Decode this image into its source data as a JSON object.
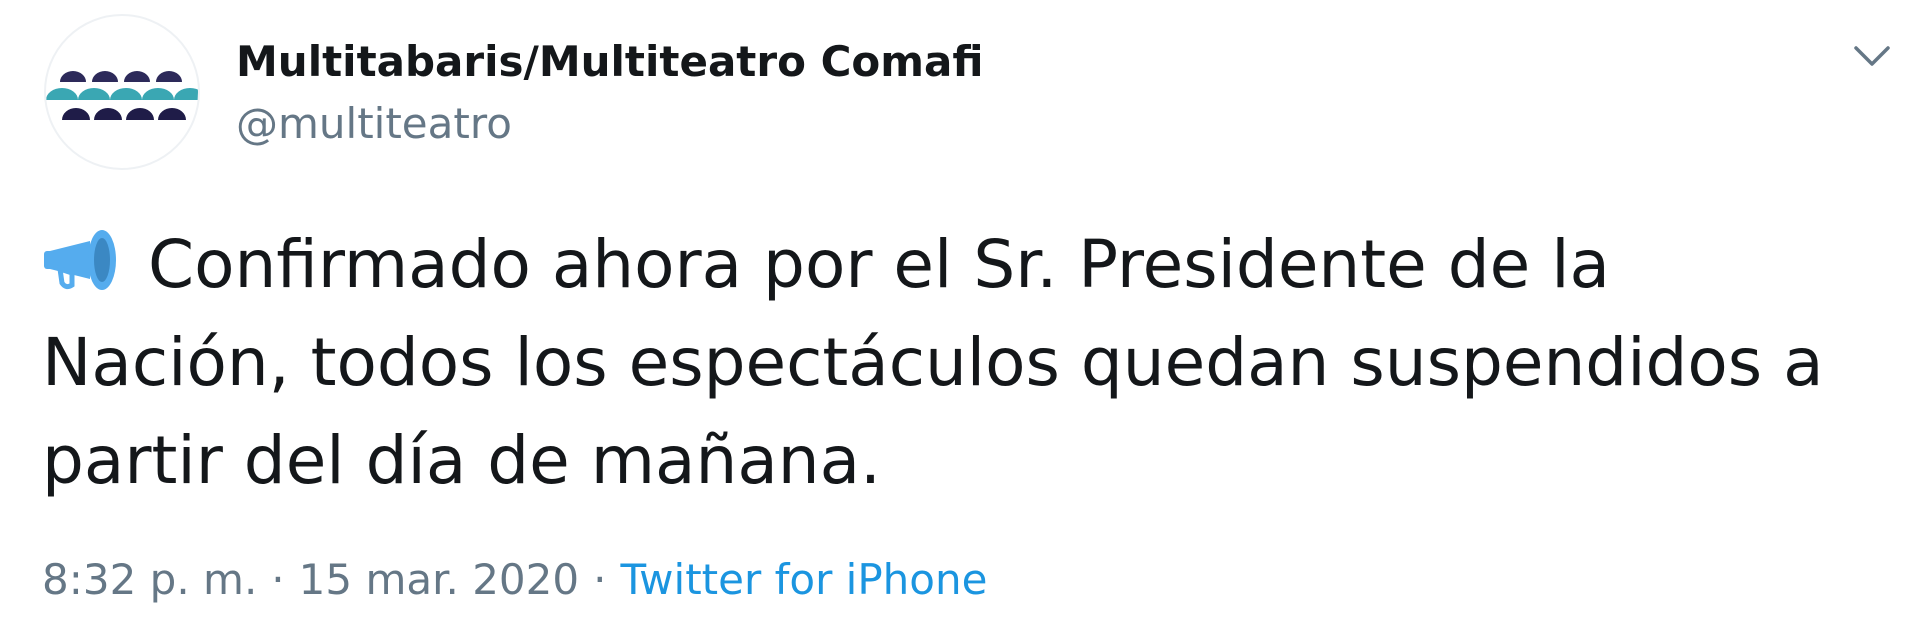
{
  "user": {
    "display_name": "Multitabaris/Multiteatro Comafi",
    "handle": "@multiteatro",
    "avatar_icon": "theater-seats-logo",
    "avatar_colors": [
      "#2d2a5a",
      "#3aa7b3",
      "#1f1c48"
    ]
  },
  "tweet": {
    "emoji_icon": "megaphone-icon",
    "text_lines": [
      "Confirmado ahora por el Sr. Presidente de la",
      "Nación, todos los espectáculos quedan suspendidos a",
      "partir del día de mañana."
    ]
  },
  "meta": {
    "time": "8:32 p. m.",
    "separator": "·",
    "date": "15 mar. 2020",
    "source": "Twitter for iPhone"
  },
  "colors": {
    "text": "#14171a",
    "secondary": "#657786",
    "link": "#1b95e0",
    "emoji_blue": "#55acee"
  },
  "menu": {
    "caret_icon": "chevron-down-icon"
  }
}
